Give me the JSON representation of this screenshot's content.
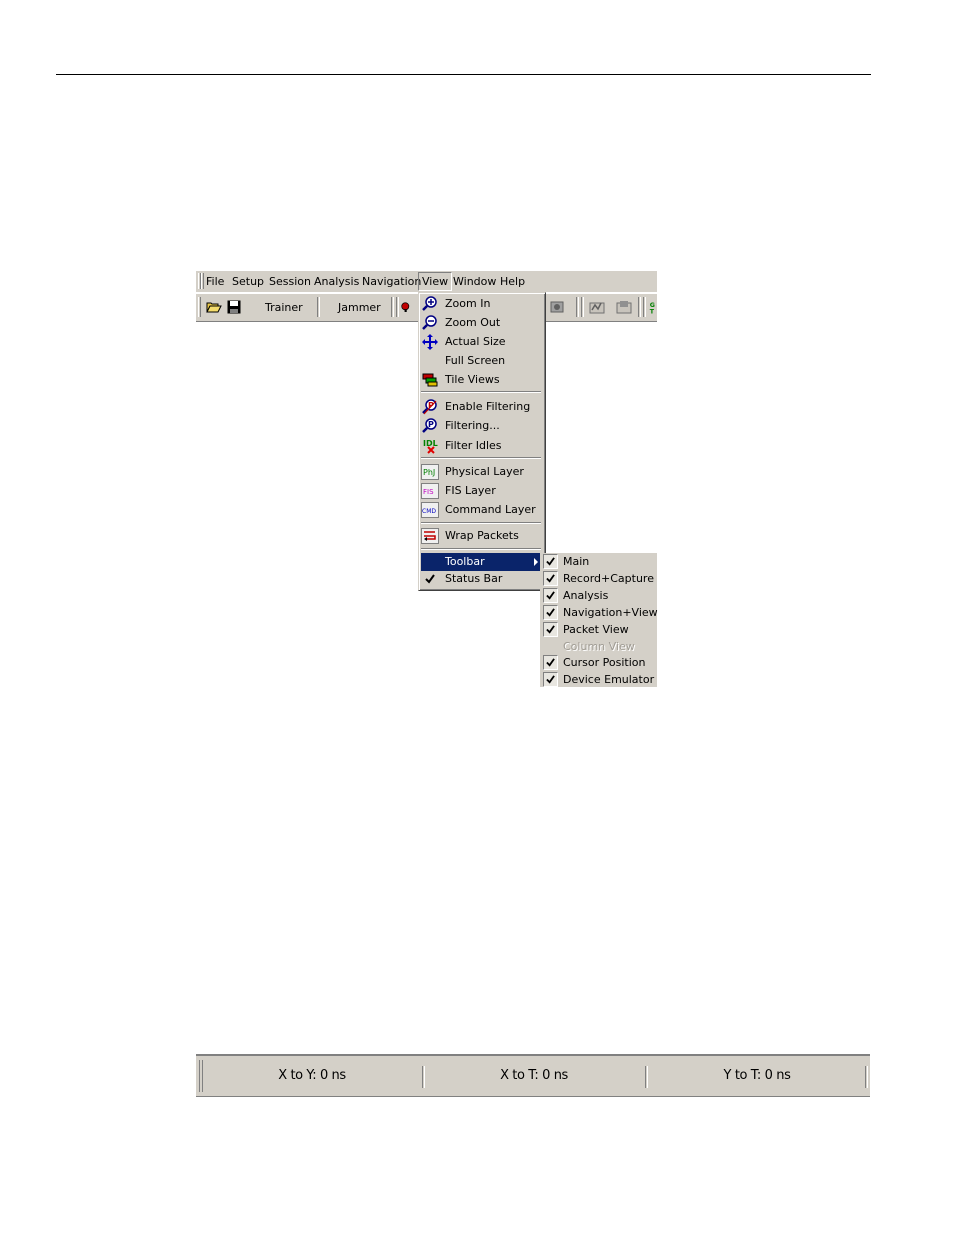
{
  "menubar": {
    "items": [
      "File",
      "Setup",
      "Session",
      "Analysis",
      "Navigation",
      "View",
      "Window",
      "Help"
    ]
  },
  "toolbar": {
    "trainer_label": "Trainer",
    "jammer_label": "Jammer"
  },
  "view_menu": {
    "items": [
      {
        "label": "Zoom In",
        "icon": "zoom-in-icon"
      },
      {
        "label": "Zoom Out",
        "icon": "zoom-out-icon"
      },
      {
        "label": "Actual Size",
        "icon": "move-arrows-icon"
      },
      {
        "label": "Full Screen",
        "icon": ""
      },
      {
        "label": "Tile Views",
        "icon": "tile-views-icon"
      },
      {
        "label": "Enable Filtering",
        "icon": "filter-icon"
      },
      {
        "label": "Filtering...",
        "icon": "filter-icon"
      },
      {
        "label": "Filter Idles",
        "icon": "filter-idles-icon"
      },
      {
        "label": "Physical Layer",
        "icon": "phy-icon",
        "icon_text": "PhJ"
      },
      {
        "label": "FIS Layer",
        "icon": "fis-icon",
        "icon_text": "FIS"
      },
      {
        "label": "Command Layer",
        "icon": "cmd-icon",
        "icon_text": "CMD"
      },
      {
        "label": "Wrap Packets",
        "icon": "wrap-icon"
      },
      {
        "label": "Toolbar",
        "highlighted": true
      },
      {
        "label": "Status Bar",
        "checked": true
      }
    ]
  },
  "toolbar_submenu": {
    "items": [
      {
        "label": "Main",
        "checked": true
      },
      {
        "label": "Record+Capture",
        "checked": true
      },
      {
        "label": "Analysis",
        "checked": true
      },
      {
        "label": "Navigation+View",
        "checked": true
      },
      {
        "label": "Packet View",
        "checked": true
      },
      {
        "label": "Column View",
        "checked": false,
        "disabled": true
      },
      {
        "label": "Cursor Position",
        "checked": true
      },
      {
        "label": "Device Emulator",
        "checked": true
      }
    ]
  },
  "statusbar": {
    "x_to_y": "X to Y: 0 ns",
    "x_to_t": "X to T: 0 ns",
    "y_to_t": "Y to T: 0 ns"
  },
  "colors": {
    "face": "#d4d0c8",
    "highlight": "#0a246a"
  }
}
